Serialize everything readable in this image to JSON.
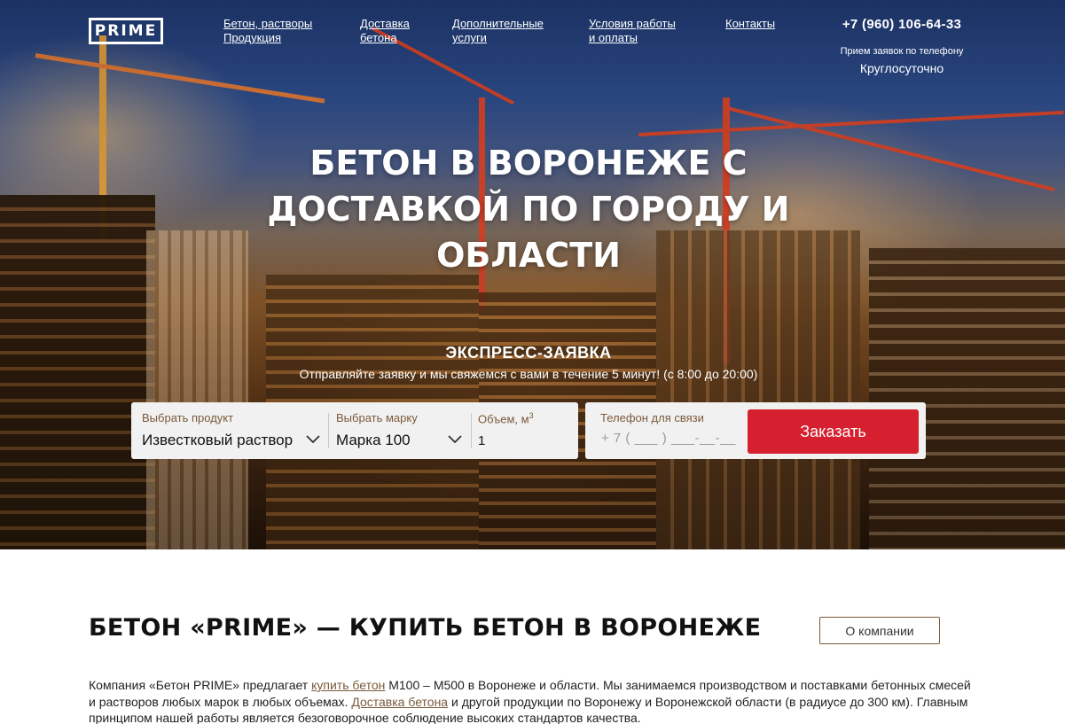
{
  "header": {
    "logo": "PRIME",
    "nav": [
      {
        "line1": "Бетон, растворы",
        "line2": "Продукция"
      },
      {
        "line1": "Доставка",
        "line2": "бетона"
      },
      {
        "line1": "Дополнительные",
        "line2": "услуги"
      },
      {
        "line1": "Условия работы",
        "line2": "и оплаты"
      },
      {
        "line1": "Контакты",
        "line2": ""
      }
    ],
    "phone": "+7 (960) 106-64-33",
    "phone_note": "Прием заявок по телефону",
    "phone_hours": "Круглосуточно"
  },
  "hero": {
    "title": "БЕТОН В ВОРОНЕЖЕ С ДОСТАВКОЙ ПО ГОРОДУ И ОБЛАСТИ",
    "express_title": "ЭКСПРЕСС-ЗАЯВКА",
    "express_sub": "Отправляйте заявку и мы свяжемся с вами в течение 5 минут! (с 8:00 до 20:00)"
  },
  "form": {
    "product_label": "Выбрать продукт",
    "product_value": "Известковый раствор",
    "grade_label": "Выбрать марку",
    "grade_value": "Марка 100",
    "volume_label": "Объем, м",
    "volume_sup": "3",
    "volume_value": "1",
    "phone_label": "Телефон для связи",
    "phone_placeholder": "+ 7 ( ___ ) ___-__-__",
    "submit": "Заказать"
  },
  "section": {
    "title": "БЕТОН «PRIME» — КУПИТЬ БЕТОН В ВОРОНЕЖЕ",
    "about_button": "О компании",
    "text_1": "Компания «Бетон PRIME» предлагает ",
    "link_1": "купить бетон",
    "text_2": " М100 – М500 в Воронеже и области. Мы занимаемся производством и поставками бетонных смесей и растворов любых марок в любых объемах. ",
    "link_2": "Доставка бетона",
    "text_3": " и другой продукции по Воронежу и Воронежской области (в радиусе до 300 км). Главным принципом нашей работы является безоговорочное соблюдение высоких стандартов качества."
  },
  "colors": {
    "accent_red": "#d6202f",
    "label_brown": "#7a5a3a"
  }
}
